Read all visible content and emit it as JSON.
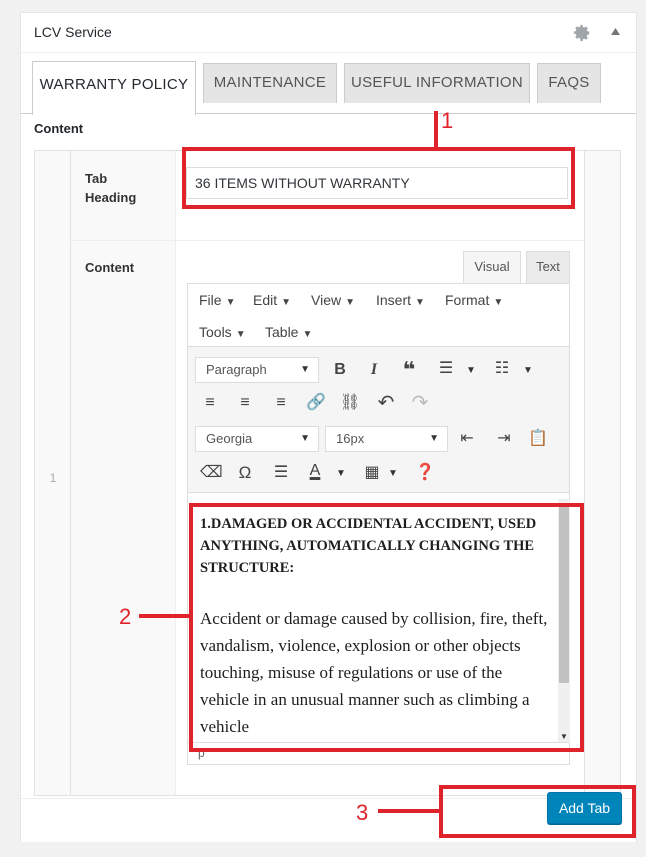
{
  "panel": {
    "title": "LCV Service"
  },
  "tabs": [
    {
      "label": "WARRANTY POLICY",
      "active": true
    },
    {
      "label": "MAINTENANCE",
      "active": false
    },
    {
      "label": "USEFUL INFORMATION",
      "active": false
    },
    {
      "label": "FAQS",
      "active": false
    }
  ],
  "content_label": "Content",
  "row": {
    "number": "1",
    "tab_heading_label": "Tab Heading",
    "tab_heading_value": "36 ITEMS WITHOUT WARRANTY",
    "content_label": "Content"
  },
  "editor": {
    "mode_tabs": {
      "visual": "Visual",
      "text": "Text"
    },
    "menus": [
      "File",
      "Edit",
      "View",
      "Insert",
      "Format",
      "Tools",
      "Table"
    ],
    "block_format": "Paragraph",
    "font_family": "Georgia",
    "font_size": "16px",
    "doc_heading": "1.DAMAGED OR ACCIDENTAL ACCIDENT, USED ANYTHING, AUTOMATICALLY CHANGING THE STRUCTURE:",
    "doc_paragraph": "Accident or damage caused by collision, fire, theft, vandalism, violence, explosion or other objects touching, misuse of regulations or use of the vehicle in an unusual manner such as climbing a vehicle",
    "status_path": "p"
  },
  "footer": {
    "add_tab_label": "Add Tab"
  },
  "annotations": [
    "1",
    "2",
    "3"
  ],
  "colors": {
    "accent": "#0085ba",
    "annotation": "#e0232a"
  }
}
